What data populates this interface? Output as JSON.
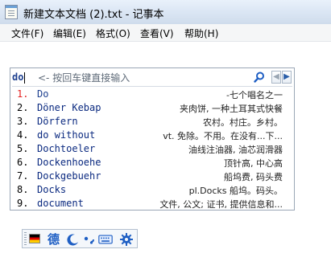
{
  "window": {
    "title": "新建文本文档 (2).txt - 记事本"
  },
  "menu": {
    "items": [
      {
        "label": "文件(F)"
      },
      {
        "label": "编辑(E)"
      },
      {
        "label": "格式(O)"
      },
      {
        "label": "查看(V)"
      },
      {
        "label": "帮助(H)"
      }
    ]
  },
  "ime": {
    "composition": "do",
    "hint": "<- 按回车键直接输入",
    "candidates": [
      {
        "num": "1.",
        "word": "Do",
        "definition": "-七个唱名之一"
      },
      {
        "num": "2.",
        "word": "Döner Kebap",
        "definition": "夹肉饼, 一种土耳其式快餐"
      },
      {
        "num": "3.",
        "word": "Dörfern",
        "definition": "农村。村庄。乡村。"
      },
      {
        "num": "4.",
        "word": "do without",
        "definition": "vt. 免除。不用。在没有...下..."
      },
      {
        "num": "5.",
        "word": "Dochtoeler",
        "definition": "油线注油器, 油芯润滑器"
      },
      {
        "num": "6.",
        "word": "Dockenhoehe",
        "definition": "顶针高, 中心高"
      },
      {
        "num": "7.",
        "word": "Dockgebuehr",
        "definition": "船坞费, 码头费"
      },
      {
        "num": "8.",
        "word": "Docks",
        "definition": "pl.Docks 船坞。码头。"
      },
      {
        "num": "9.",
        "word": "document",
        "definition": "文件, 公文; 证书, 提供信息和..."
      }
    ],
    "colors": {
      "selected_number": "#e41e1e",
      "word": "#0b2a80",
      "accent": "#1f5fc4"
    }
  },
  "toolbar": {
    "logo_char": "德",
    "icons": [
      "german-flag-icon",
      "moon-icon",
      "punctuation-icon",
      "keyboard-icon",
      "gear-icon"
    ]
  }
}
